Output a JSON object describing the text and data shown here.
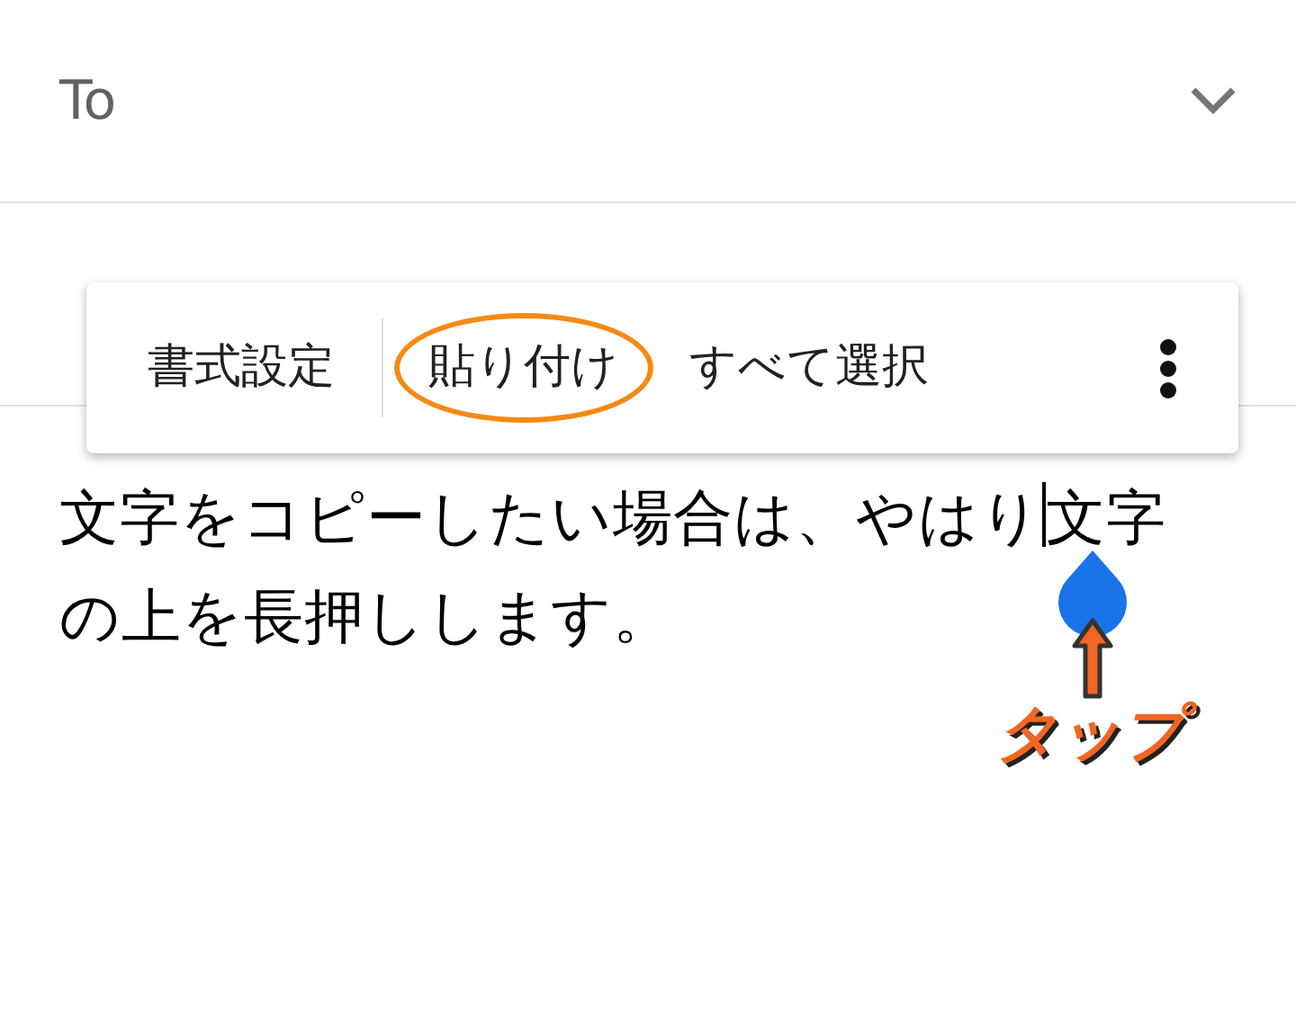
{
  "to_field": {
    "label": "To",
    "expanded": false
  },
  "context_menu": {
    "items": [
      {
        "label": "書式設定",
        "highlighted": false
      },
      {
        "label": "貼り付け",
        "highlighted": true
      },
      {
        "label": "すべて選択",
        "highlighted": false
      }
    ]
  },
  "body": {
    "text_before_cursor": "文字をコピーしたい場合は、やはり",
    "text_after_cursor": "文字の上を長押しします。"
  },
  "annotation": {
    "label": "タップ"
  }
}
